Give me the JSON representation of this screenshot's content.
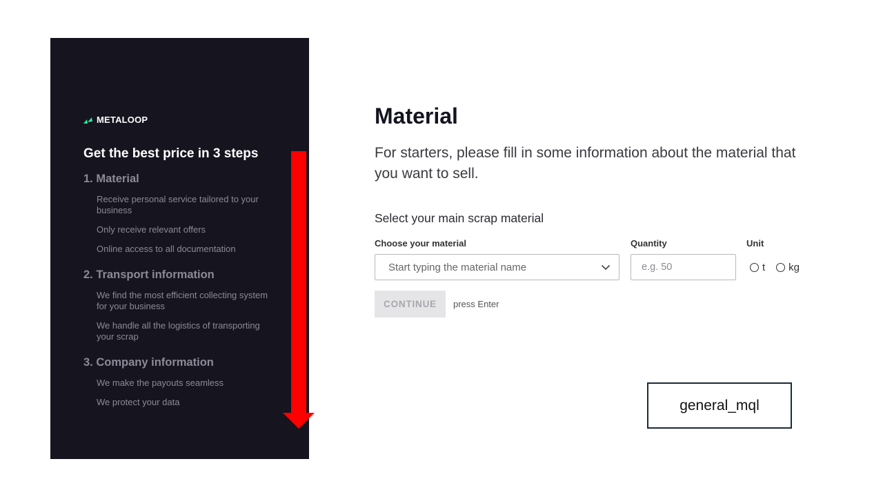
{
  "sidebar": {
    "logo_text": "METALOOP",
    "title": "Get the best price in 3 steps",
    "steps": [
      {
        "heading": "1. Material",
        "items": [
          "Receive personal service tailored to your business",
          "Only receive relevant offers",
          "Online access to all documentation"
        ]
      },
      {
        "heading": "2. Transport information",
        "items": [
          "We find the most efficient collecting system for your business",
          "We handle all the logistics of transporting your scrap"
        ]
      },
      {
        "heading": "3. Company information",
        "items": [
          "We make the payouts seamless",
          "We protect your data"
        ]
      }
    ]
  },
  "main": {
    "title": "Material",
    "intro": "For starters, please fill in some information about the material that you want to sell.",
    "section_label": "Select your main scrap material",
    "material": {
      "label": "Choose your material",
      "placeholder": "Start typing the material name"
    },
    "quantity": {
      "label": "Quantity",
      "placeholder": "e.g. 50",
      "value": ""
    },
    "unit": {
      "label": "Unit",
      "options": [
        "t",
        "kg"
      ]
    },
    "continue_label": "CONTINUE",
    "press_enter": "press Enter"
  },
  "annotation": {
    "text": "general_mql"
  },
  "colors": {
    "sidebar_bg": "#16141f",
    "brand_green": "#2ee89a",
    "arrow_red": "#ff0000",
    "muted_text": "#8b8a96",
    "button_disabled_bg": "#e5e5e7"
  },
  "icons": {
    "logo": "metaloop-logo-icon",
    "dropdown": "chevron-down-icon",
    "arrow": "arrow-down-icon"
  }
}
